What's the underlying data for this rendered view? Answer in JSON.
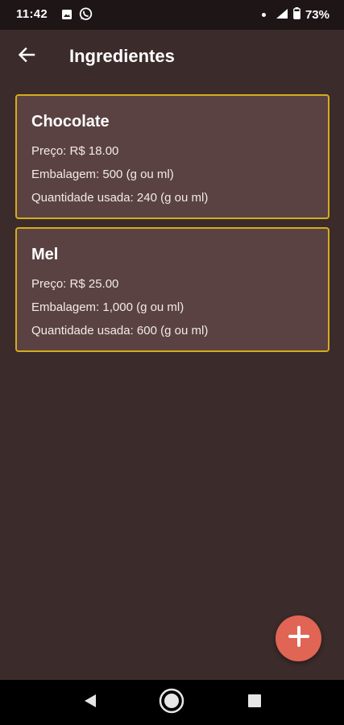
{
  "status_bar": {
    "time": "11:42",
    "battery": "73%",
    "icons": [
      "image-icon",
      "whatsapp-icon",
      "notification-dot-icon",
      "signal-icon",
      "battery-icon"
    ]
  },
  "app_bar": {
    "title": "Ingredientes",
    "back_icon": "arrow-left-icon"
  },
  "ingredients": [
    {
      "name": "Chocolate",
      "price": "Preço: R$ 18.00",
      "package": "Embalagem: 500 (g ou ml)",
      "used": "Quantidade usada: 240 (g ou ml)"
    },
    {
      "name": "Mel",
      "price": "Preço: R$ 25.00",
      "package": "Embalagem: 1,000 (g ou ml)",
      "used": "Quantidade usada: 600 (g ou ml)"
    }
  ],
  "fab": {
    "icon": "plus-icon"
  },
  "nav_bar": {
    "buttons": [
      "back-triangle-icon",
      "home-circle-icon",
      "recents-square-icon"
    ]
  },
  "colors": {
    "background": "#3b2b2b",
    "card": "#5b4242",
    "card_border": "#d4ac1f",
    "fab": "#e06554",
    "status_bar": "#1e1616",
    "nav_bar": "#000000"
  }
}
